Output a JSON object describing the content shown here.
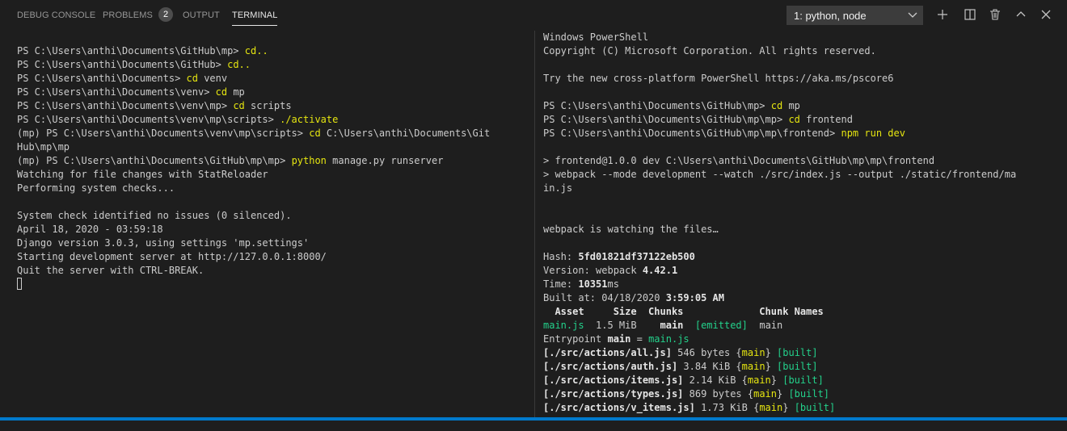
{
  "panel": {
    "tabs": [
      {
        "label": "DEBUG CONSOLE"
      },
      {
        "label": "PROBLEMS",
        "badge": "2"
      },
      {
        "label": "OUTPUT"
      },
      {
        "label": "TERMINAL",
        "active": true
      }
    ],
    "terminal_select": "1: python, node",
    "actions": [
      "plus-icon",
      "split-icon",
      "trash-icon",
      "chevron-up-icon",
      "close-icon"
    ]
  },
  "colors": {
    "background": "#1e1e1e",
    "text": "#cccccc",
    "command_yellow": "#e5e510",
    "green": "#23d18b",
    "accent": "#007acc"
  },
  "left_terminal": {
    "lines": [
      [
        {
          "t": "PS C:\\Users\\anthi\\Documents\\GitHub\\mp> "
        },
        {
          "t": "cd..",
          "c": "cmd"
        }
      ],
      [
        {
          "t": "PS C:\\Users\\anthi\\Documents\\GitHub> "
        },
        {
          "t": "cd..",
          "c": "cmd"
        }
      ],
      [
        {
          "t": "PS C:\\Users\\anthi\\Documents> "
        },
        {
          "t": "cd",
          "c": "cmd"
        },
        {
          "t": " venv"
        }
      ],
      [
        {
          "t": "PS C:\\Users\\anthi\\Documents\\venv> "
        },
        {
          "t": "cd",
          "c": "cmd"
        },
        {
          "t": " mp"
        }
      ],
      [
        {
          "t": "PS C:\\Users\\anthi\\Documents\\venv\\mp> "
        },
        {
          "t": "cd",
          "c": "cmd"
        },
        {
          "t": " scripts"
        }
      ],
      [
        {
          "t": "PS C:\\Users\\anthi\\Documents\\venv\\mp\\scripts> "
        },
        {
          "t": "./activate",
          "c": "cmd"
        }
      ],
      [
        {
          "t": "(mp) PS C:\\Users\\anthi\\Documents\\venv\\mp\\scripts> "
        },
        {
          "t": "cd",
          "c": "cmd"
        },
        {
          "t": " C:\\Users\\anthi\\Documents\\Git"
        }
      ],
      [
        {
          "t": "Hub\\mp\\mp"
        }
      ],
      [
        {
          "t": "(mp) PS C:\\Users\\anthi\\Documents\\GitHub\\mp\\mp> "
        },
        {
          "t": "python",
          "c": "cmd"
        },
        {
          "t": " manage.py runserver"
        }
      ],
      [
        {
          "t": "Watching for file changes with StatReloader"
        }
      ],
      [
        {
          "t": "Performing system checks..."
        }
      ],
      [],
      [
        {
          "t": "System check identified no issues (0 silenced)."
        }
      ],
      [
        {
          "t": "April 18, 2020 - 03:59:18"
        }
      ],
      [
        {
          "t": "Django version 3.0.3, using settings 'mp.settings'"
        }
      ],
      [
        {
          "t": "Starting development server at http://127.0.0.1:8000/"
        }
      ],
      [
        {
          "t": "Quit the server with CTRL-BREAK."
        }
      ],
      [
        {
          "cursor": true
        }
      ]
    ]
  },
  "right_terminal": {
    "lines": [
      [
        {
          "t": "Windows PowerShell"
        }
      ],
      [
        {
          "t": "Copyright (C) Microsoft Corporation. All rights reserved."
        }
      ],
      [],
      [
        {
          "t": "Try the new cross-platform PowerShell https://aka.ms/pscore6"
        }
      ],
      [],
      [
        {
          "t": "PS C:\\Users\\anthi\\Documents\\GitHub\\mp> "
        },
        {
          "t": "cd",
          "c": "cmd"
        },
        {
          "t": " mp"
        }
      ],
      [
        {
          "t": "PS C:\\Users\\anthi\\Documents\\GitHub\\mp\\mp> "
        },
        {
          "t": "cd",
          "c": "cmd"
        },
        {
          "t": " frontend"
        }
      ],
      [
        {
          "t": "PS C:\\Users\\anthi\\Documents\\GitHub\\mp\\mp\\frontend> "
        },
        {
          "t": "npm",
          "c": "cmd"
        },
        {
          "t": " run dev",
          "c": "cmd"
        }
      ],
      [],
      [
        {
          "t": "> frontend@1.0.0 dev C:\\Users\\anthi\\Documents\\GitHub\\mp\\mp\\frontend"
        }
      ],
      [
        {
          "t": "> webpack --mode development --watch ./src/index.js --output ./static/frontend/ma"
        }
      ],
      [
        {
          "t": "in.js"
        }
      ],
      [],
      [],
      [
        {
          "t": "webpack is watching the files…"
        }
      ],
      [],
      [
        {
          "t": "Hash: "
        },
        {
          "t": "5fd01821df37122eb500",
          "c": "b"
        }
      ],
      [
        {
          "t": "Version: webpack "
        },
        {
          "t": "4.42.1",
          "c": "b"
        }
      ],
      [
        {
          "t": "Time: "
        },
        {
          "t": "10351",
          "c": "b"
        },
        {
          "t": "ms"
        }
      ],
      [
        {
          "t": "Built at: 04/18/2020 "
        },
        {
          "t": "3:59:05 AM",
          "c": "b"
        }
      ],
      [
        {
          "t": "  Asset     Size  Chunks             Chunk Names",
          "c": "b"
        }
      ],
      [
        {
          "t": "main.js",
          "c": "g"
        },
        {
          "t": "  1.5 MiB    "
        },
        {
          "t": "main",
          "c": "b"
        },
        {
          "t": "  "
        },
        {
          "t": "[emitted]",
          "c": "g"
        },
        {
          "t": "  main"
        }
      ],
      [
        {
          "t": "Entrypoint "
        },
        {
          "t": "main",
          "c": "b"
        },
        {
          "t": " = "
        },
        {
          "t": "main.js",
          "c": "g"
        }
      ],
      [
        {
          "t": "[./src/actions/all.js]",
          "c": "b"
        },
        {
          "t": " 546 bytes {"
        },
        {
          "t": "main",
          "c": "y"
        },
        {
          "t": "} "
        },
        {
          "t": "[built]",
          "c": "g"
        }
      ],
      [
        {
          "t": "[./src/actions/auth.js]",
          "c": "b"
        },
        {
          "t": " 3.84 KiB {"
        },
        {
          "t": "main",
          "c": "y"
        },
        {
          "t": "} "
        },
        {
          "t": "[built]",
          "c": "g"
        }
      ],
      [
        {
          "t": "[./src/actions/items.js]",
          "c": "b"
        },
        {
          "t": " 2.14 KiB {"
        },
        {
          "t": "main",
          "c": "y"
        },
        {
          "t": "} "
        },
        {
          "t": "[built]",
          "c": "g"
        }
      ],
      [
        {
          "t": "[./src/actions/types.js]",
          "c": "b"
        },
        {
          "t": " 869 bytes {"
        },
        {
          "t": "main",
          "c": "y"
        },
        {
          "t": "} "
        },
        {
          "t": "[built]",
          "c": "g"
        }
      ],
      [
        {
          "t": "[./src/actions/v_items.js]",
          "c": "b"
        },
        {
          "t": " 1.73 KiB {"
        },
        {
          "t": "main",
          "c": "y"
        },
        {
          "t": "} "
        },
        {
          "t": "[built]",
          "c": "g"
        }
      ]
    ]
  }
}
